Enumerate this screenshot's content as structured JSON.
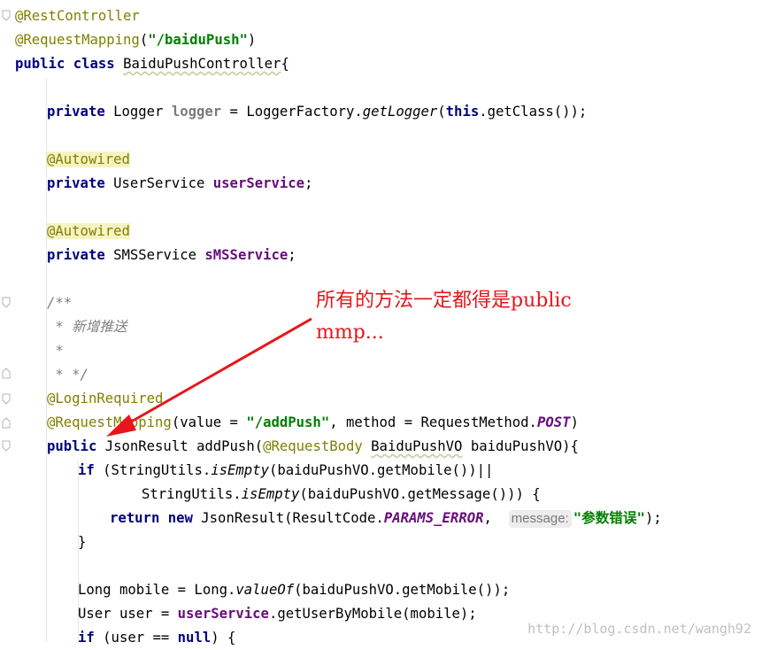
{
  "code": {
    "l1": "@RestController",
    "l2_ann": "@RequestMapping",
    "l2_open": "(",
    "l2_str": "\"/baiduPush\"",
    "l2_close": ")",
    "l3_kw": "public class ",
    "l3_name": "BaiduPushController",
    "l3_brace": "{",
    "l5_kw": "private ",
    "l5_type": "Logger ",
    "l5_field": "logger",
    "l5_eq": " = LoggerFactory.",
    "l5_method": "getLogger",
    "l5_open": "(",
    "l5_this": "this",
    "l5_rest": ".getClass());",
    "l7_ann": "@Autowired",
    "l8_kw": "private ",
    "l8_type": "UserService ",
    "l8_field": "userService",
    "l8_semi": ";",
    "l10_ann": "@Autowired",
    "l11_kw": "private ",
    "l11_type": "SMSService ",
    "l11_field": "sMSService",
    "l11_semi": ";",
    "l13": "/**",
    "l14": " * 新增推送",
    "l15": " *",
    "l16": " * */",
    "l17": "@LoginRequired",
    "l18_ann": "@RequestMapping",
    "l18_a": "(value = ",
    "l18_str": "\"/addPush\"",
    "l18_b": ", method = RequestMethod.",
    "l18_const": "POST",
    "l18_c": ")",
    "l19_kw": "public ",
    "l19_a": "JsonResult addPush(",
    "l19_ann": "@RequestBody ",
    "l19_type": "BaiduPushVO",
    "l19_b": " baiduPushVO){",
    "l20_kw": "if ",
    "l20_a": "(StringUtils.",
    "l20_m": "isEmpty",
    "l20_b": "(baiduPushVO.getMobile())||",
    "l21_a": "StringUtils.",
    "l21_m": "isEmpty",
    "l21_b": "(baiduPushVO.getMessage())) {",
    "l22_kw1": "return new ",
    "l22_a": "JsonResult(ResultCode.",
    "l22_const": "PARAMS_ERROR",
    "l22_b": ",  ",
    "l22_hint": "message:",
    "l22_str": "\"参数错误\"",
    "l22_c": ");",
    "l23": "}",
    "l25": "Long mobile = Long.",
    "l25_m": "valueOf",
    "l25_b": "(baiduPushVO.getMobile());",
    "l26_a": "User user = ",
    "l26_field": "userService",
    "l26_b": ".getUserByMobile(mobile);",
    "l27_kw": "if ",
    "l27_a": "(user == ",
    "l27_kw2": "null",
    "l27_b": ") {"
  },
  "annotation": {
    "line1": "所有的方法一定都得是public",
    "line2": "mmp...",
    "color": "#e8151c"
  },
  "watermark": "http://blog.csdn.net/wangh92"
}
